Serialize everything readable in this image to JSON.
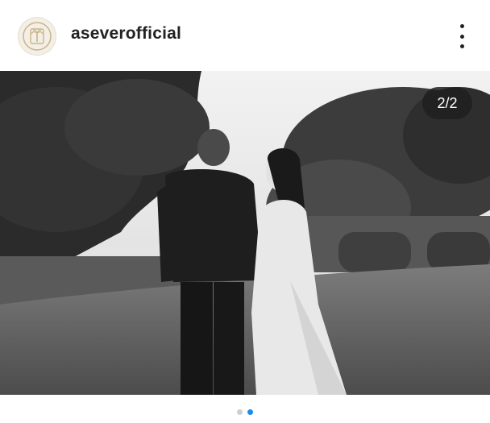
{
  "post": {
    "username": "aseverofficial",
    "avatar_icon": "palm-tree-crest-icon",
    "more_icon": "more-vertical-icon"
  },
  "carousel": {
    "counter": "2/2",
    "current": 2,
    "total": 2,
    "active_dot_color": "#1a8cf0",
    "inactive_dot_color": "#cfcfcf"
  },
  "photo": {
    "description_style": "black-and-white",
    "icon": "photo"
  }
}
